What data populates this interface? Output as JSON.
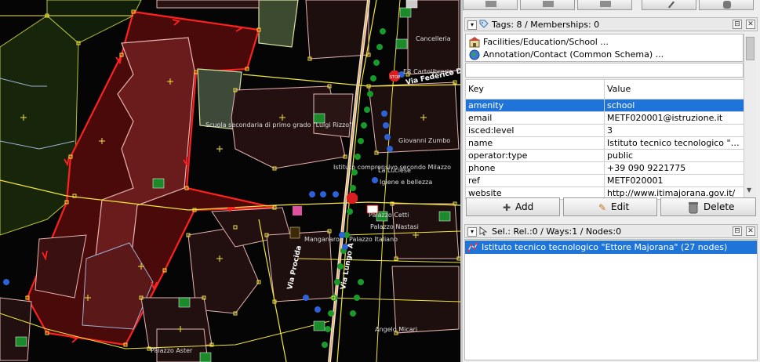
{
  "map": {
    "labels": {
      "school": "Scuola secondaria di primo grado \"Luigi Rizzo\"",
      "istituto": "Istituto comprensivo secondo Milazzo",
      "luciese": "La Luciese",
      "igiene": "Igiene e bellezza",
      "cartolibreria": "ER Cartolibreria",
      "federico": "Via Federico De Rosa",
      "zumbo": "Giovanni Zumbo",
      "cancelleria": "Cancelleria",
      "nastasi": "Palazzo Nastasi",
      "cetti": "Palazzo Cetti",
      "italiano": "Palazzo Italiano",
      "manganaro": "Manganaro",
      "aster": "Palazzo Aster",
      "micari": "Angelo Micari",
      "procida": "Via Procida",
      "via_a": "Via Lungo A",
      "stop": "STOP"
    }
  },
  "panel": {
    "tags": {
      "title": "Tags: 8 / Memberships: 0",
      "memberships": [
        {
          "label": "Facilities/Education/School ...",
          "icon": "school-preset-icon"
        },
        {
          "label": "Annotation/Contact (Common Schema) ...",
          "icon": "globe-icon"
        }
      ],
      "columns": {
        "key": "Key",
        "value": "Value"
      },
      "rows": [
        {
          "key": "amenity",
          "value": "school",
          "selected": true
        },
        {
          "key": "email",
          "value": "METF020001@istruzione.it"
        },
        {
          "key": "isced:level",
          "value": "3"
        },
        {
          "key": "name",
          "value": "Istituto tecnico tecnologico \"Ettore..."
        },
        {
          "key": "operator:type",
          "value": "public"
        },
        {
          "key": "phone",
          "value": "+39 090 9221775"
        },
        {
          "key": "ref",
          "value": "METF020001"
        },
        {
          "key": "website",
          "value": "http://www.itimajorana.gov.it/"
        }
      ],
      "buttons": {
        "add": "Add",
        "edit": "Edit",
        "delete": "Delete"
      }
    },
    "selection": {
      "title": "Sel.: Rel.:0 / Ways:1 / Nodes:0",
      "items": [
        {
          "label": "Istituto tecnico tecnologico \"Ettore Majorana\" (27 nodes)"
        }
      ]
    }
  },
  "colors": {
    "selected_row": "#1e74d9",
    "selected_area": "#ff2020",
    "way_yellow": "#f2e63a",
    "building_pink": "#e7b4b0",
    "forest_green": "#1a9a2a"
  }
}
